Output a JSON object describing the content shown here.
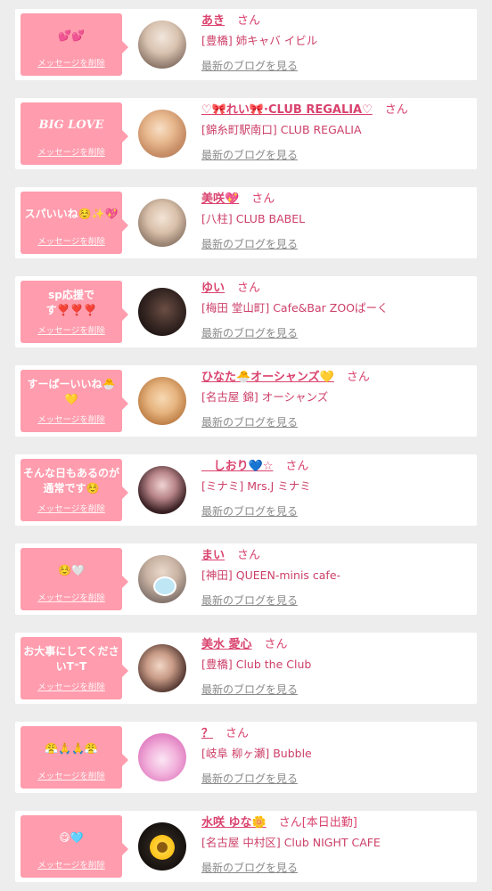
{
  "delete_label": "メッセージを削除",
  "blog_label": "最新のブログを見る",
  "san_label": "さん",
  "colors": {
    "bubble": "#ff9cad",
    "name": "#d9436e",
    "background": "#ededed"
  },
  "entries": [
    {
      "message": "💕💕",
      "name": "あき",
      "extra": "",
      "store": "[豊橋] 姉キャバ イビル"
    },
    {
      "message": "BIG LOVE",
      "name": "♡🎀れい🎀·CLUB REGALIA♡",
      "extra": "",
      "store": "[錦糸町駅南口] CLUB REGALIA"
    },
    {
      "message": "スパいいね☺️✨💖",
      "name": "美咲💖",
      "extra": "",
      "store": "[八柱] CLUB BABEL"
    },
    {
      "message": "sp応援です❣️❣️❣️",
      "name": "ゆい",
      "extra": "",
      "store": "[梅田 堂山町] Cafe&Bar ZOOぱーく"
    },
    {
      "message": "すーぱーいいね🐣💛",
      "name": "ひなた🐣オーシャンズ💛",
      "extra": "",
      "store": "[名古屋 錦] オーシャンズ"
    },
    {
      "message": "そんな日もあるのが通常です☺️",
      "name": "   しおり💙☆",
      "extra": "",
      "store": "[ミナミ] Mrs.J ミナミ"
    },
    {
      "message": "☺️🤍",
      "name": "まい",
      "extra": "",
      "store": "[神田] QUEEN-minis cafe-"
    },
    {
      "message": "お大事にしてくださいT⁼T",
      "name": "美水 愛心",
      "extra": "",
      "store": "[豊橋] Club the Club"
    },
    {
      "message": "😤🙏🙏😤",
      "name": "？",
      "extra": "",
      "store": "[岐阜 柳ヶ瀬] Bubble"
    },
    {
      "message": "😋🩵",
      "name": "水咲 ゆな🌼",
      "extra": "[本日出勤]",
      "store": "[名古屋 中村区] Club NIGHT CAFE"
    }
  ]
}
